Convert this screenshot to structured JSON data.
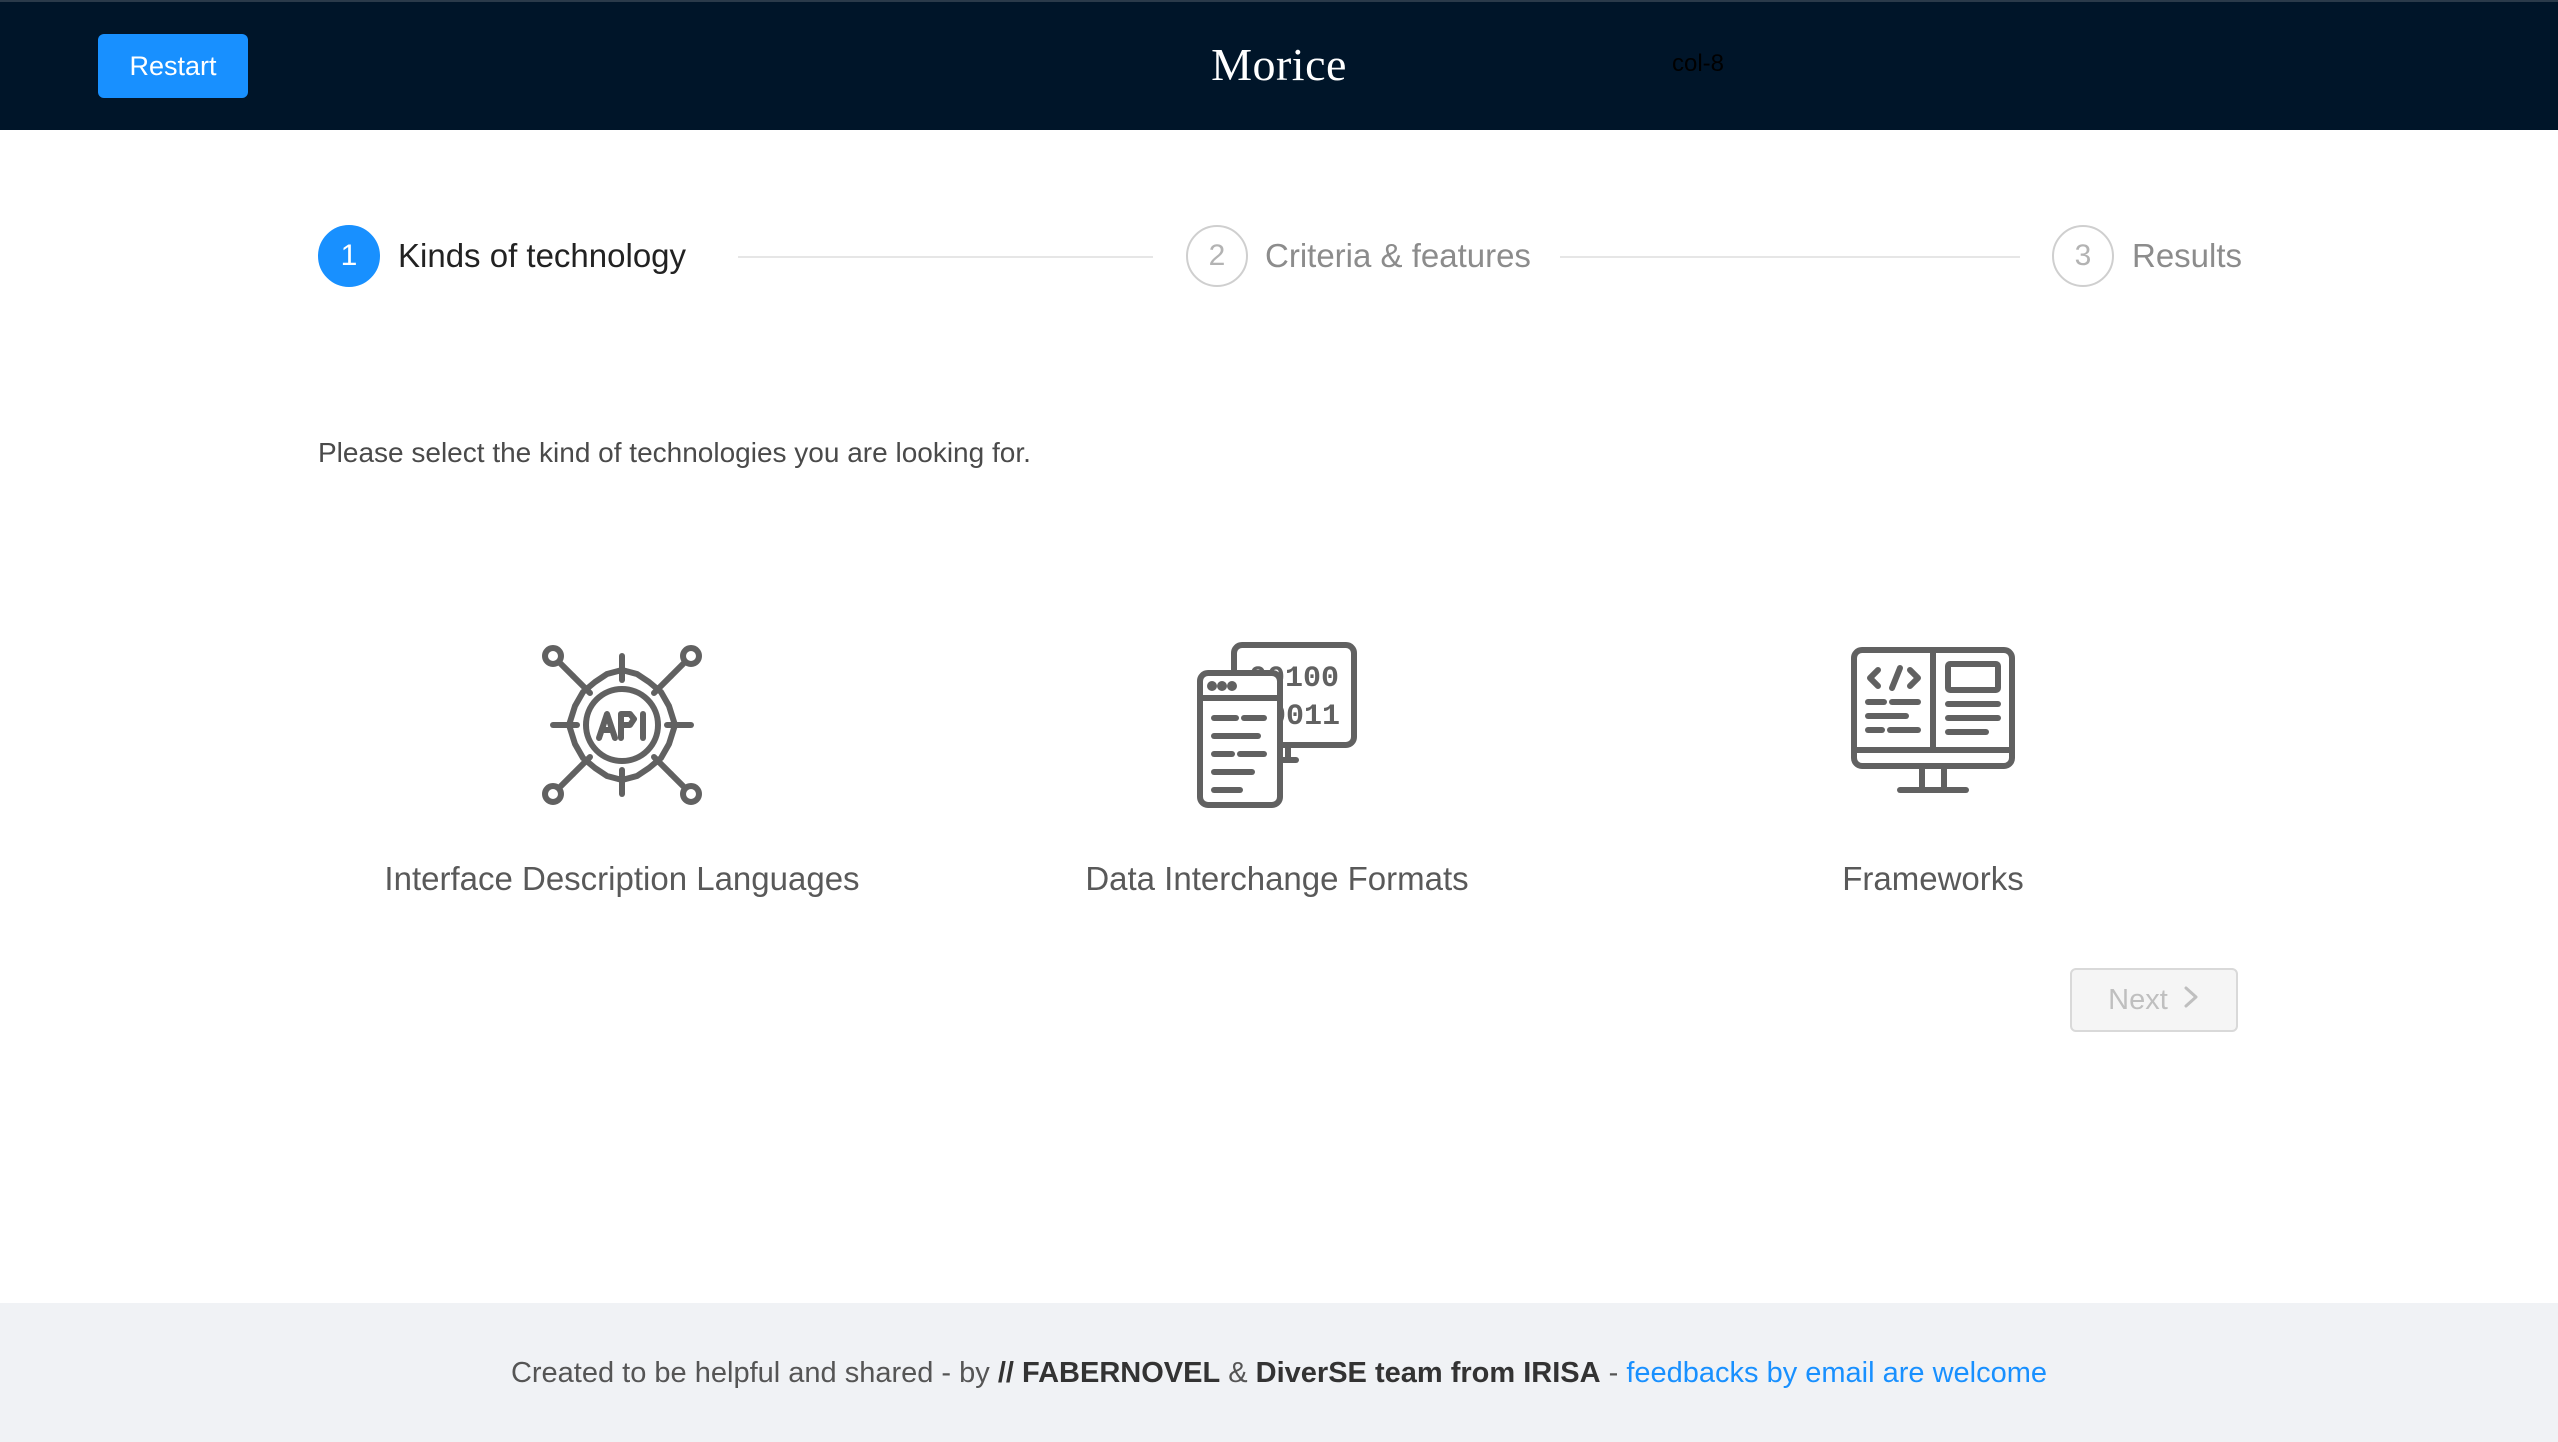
{
  "header": {
    "restart_label": "Restart",
    "brand": "Morice",
    "ghost_text": "col-8"
  },
  "steps": [
    {
      "number": "1",
      "title": "Kinds of technology",
      "state": "active"
    },
    {
      "number": "2",
      "title": "Criteria & features",
      "state": "wait"
    },
    {
      "number": "3",
      "title": "Results",
      "state": "wait"
    }
  ],
  "prompt": "Please select the kind of technologies you are looking for.",
  "options": [
    {
      "label": "Interface Description Languages",
      "icon": "api-gear-icon"
    },
    {
      "label": "Data Interchange Formats",
      "icon": "data-documents-icon"
    },
    {
      "label": "Frameworks",
      "icon": "code-monitor-icon"
    }
  ],
  "next": {
    "label": "Next",
    "icon": "chevron-right-icon"
  },
  "footer": {
    "prefix": "Created to be helpful and shared - by ",
    "org1": "// FABERNOVEL",
    "amp": " & ",
    "org2": "DiverSE team from IRISA",
    "dash": " - ",
    "link": "feedbacks by email are welcome"
  },
  "colors": {
    "header_bg": "#001529",
    "accent": "#1890ff",
    "footer_bg": "#f0f2f5"
  }
}
